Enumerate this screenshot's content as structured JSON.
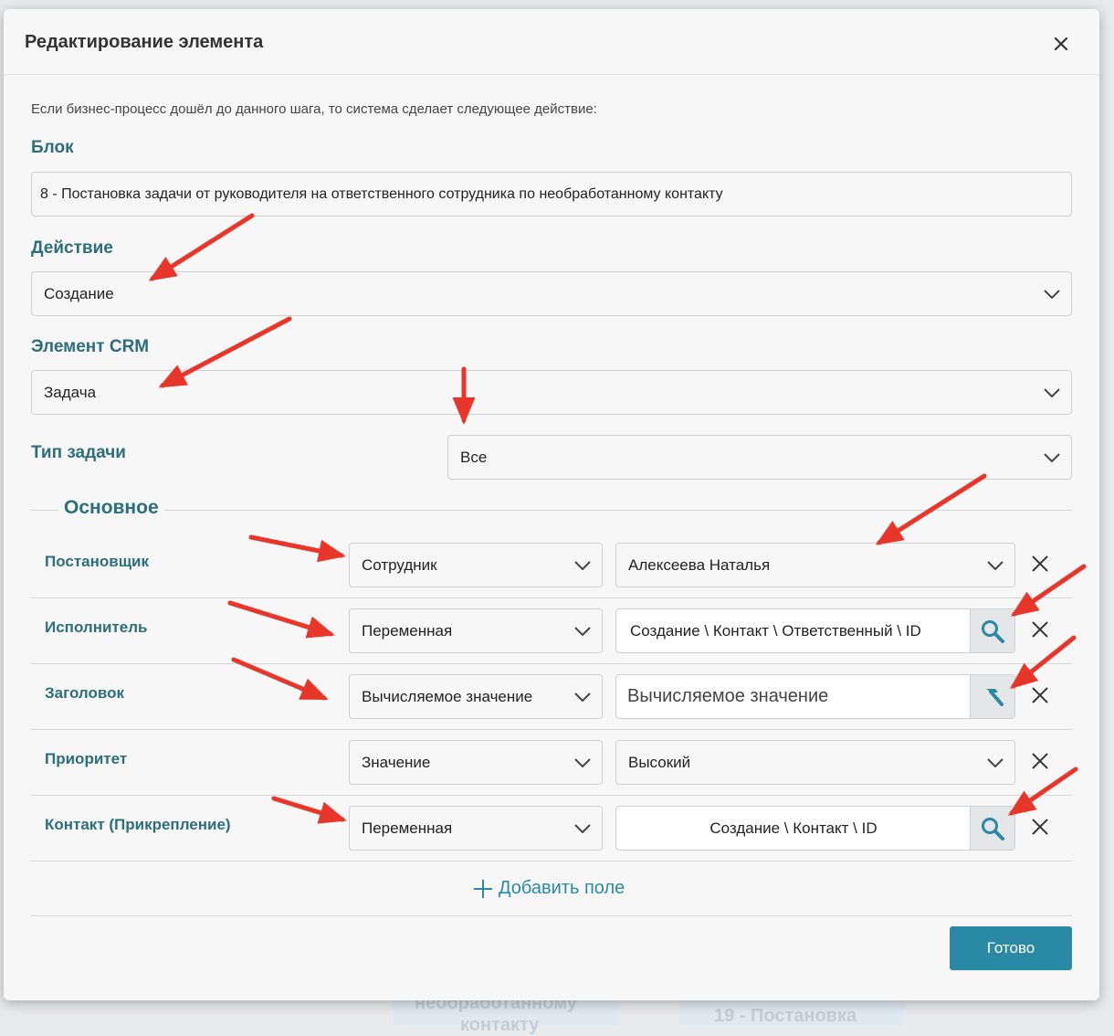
{
  "background": {
    "card1_line1": "необработанному",
    "card1_line2": "контакту",
    "card2_line1": "19 - Постановка"
  },
  "modal": {
    "title": "Редактирование элемента",
    "intro": "Если бизнес-процесс дошёл до данного шага, то система сделает следующее действие:",
    "block": {
      "label": "Блок",
      "value": "8 - Постановка задачи от руководителя на ответственного сотрудника по необработанному контакту"
    },
    "action": {
      "label": "Действие",
      "value": "Создание"
    },
    "crm_element": {
      "label": "Элемент CRM",
      "value": "Задача"
    },
    "task_type": {
      "label": "Тип задачи",
      "value": "Все"
    },
    "section_title": "Основное",
    "rows": [
      {
        "label": "Постановщик",
        "type": "Сотрудник",
        "value": "Алексеева Наталья"
      },
      {
        "label": "Исполнитель",
        "type": "Переменная",
        "value": "Создание \\ Контакт \\ Ответственный \\ ID"
      },
      {
        "label": "Заголовок",
        "type": "Вычисляемое значение",
        "value": "Вычисляемое значение"
      },
      {
        "label": "Приоритет",
        "type": "Значение",
        "value": "Высокий"
      },
      {
        "label": "Контакт (Прикрепление)",
        "type": "Переменная",
        "value": "Создание \\ Контакт \\ ID"
      }
    ],
    "add_field_label": "Добавить поле",
    "done_label": "Готово"
  },
  "colors": {
    "accent": "#2a8aa6",
    "label": "#2c6e7c",
    "annotation_arrow": "#e8362a"
  }
}
